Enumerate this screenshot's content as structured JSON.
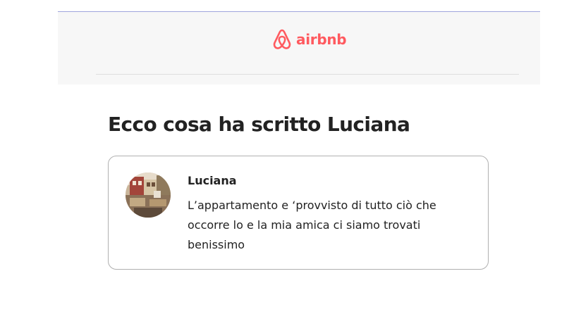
{
  "header": {
    "logo_icon": "airbnb-belo-icon",
    "logo_text": "airbnb",
    "brand_color": "#ff5a5f"
  },
  "main": {
    "heading": "Ecco cosa ha scritto Luciana",
    "review": {
      "reviewer_name": "Luciana",
      "text": "L’appartamento e ‘provvisto di tutto ciò che occorre lo e la mia amica ci siamo trovati benissimo"
    }
  }
}
